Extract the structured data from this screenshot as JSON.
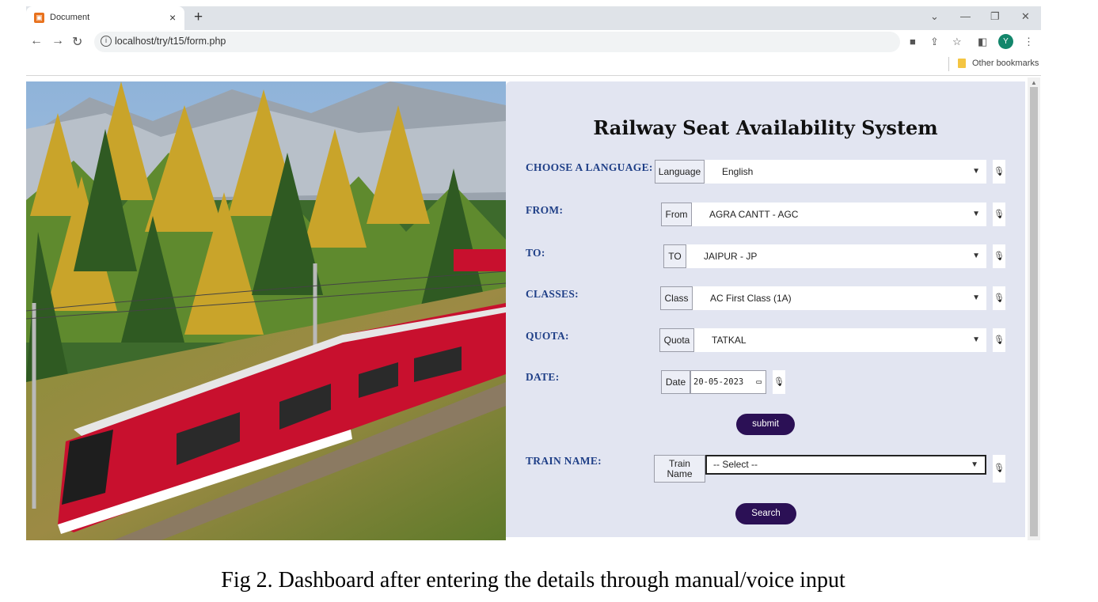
{
  "browser": {
    "tab_title": "Document",
    "tab_close": "×",
    "new_tab": "+",
    "url": "localhost/try/t15/form.php",
    "profile_initial": "Y",
    "bookmarks_label": "Other bookmarks"
  },
  "form": {
    "title": "Railway Seat Availability System",
    "language": {
      "label": "CHOOSE A LANGUAGE:",
      "addon": "Language",
      "value": "English"
    },
    "from": {
      "label": "FROM:",
      "addon": "From",
      "value": "AGRA CANTT - AGC"
    },
    "to": {
      "label": "TO:",
      "addon": "TO",
      "value": "JAIPUR - JP"
    },
    "classes": {
      "label": "CLASSES:",
      "addon": "Class",
      "value": "AC First Class (1A)"
    },
    "quota": {
      "label": "QUOTA:",
      "addon": "Quota",
      "value": "TATKAL"
    },
    "date": {
      "label": "DATE:",
      "addon": "Date",
      "value": "20-05-2023"
    },
    "submit_label": "submit",
    "train": {
      "label": "TRAIN NAME:",
      "addon_line1": "Train",
      "addon_line2": "Name",
      "value": "-- Select --"
    },
    "search_label": "Search"
  },
  "caption": "Fig 2. Dashboard after entering the details through manual/voice input",
  "colors": {
    "label_blue": "#1f3f87",
    "button_purple": "#2b1055",
    "panel_bg": "#e2e5f1"
  },
  "icons": [
    "document-favicon",
    "back-arrow-icon",
    "forward-arrow-icon",
    "reload-icon",
    "info-icon",
    "camera-icon",
    "share-icon",
    "star-icon",
    "sidepanel-icon",
    "menu-dots-icon",
    "folder-icon",
    "mic-icon",
    "calendar-icon",
    "chevron-down-icon"
  ]
}
